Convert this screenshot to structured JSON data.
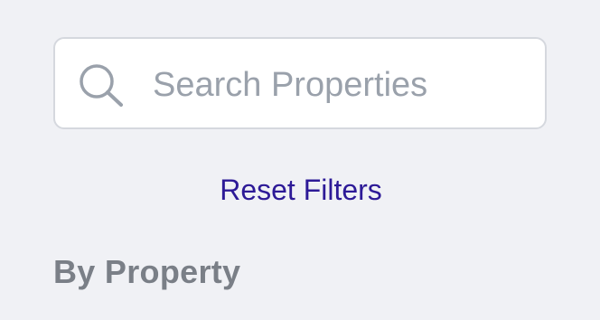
{
  "search": {
    "placeholder": "Search Properties",
    "value": "",
    "icon": "search-icon"
  },
  "filters": {
    "reset_label": "Reset Filters"
  },
  "sections": {
    "by_property_heading": "By Property"
  },
  "colors": {
    "background": "#f0f1f5",
    "input_background": "#ffffff",
    "input_border": "#d5d8de",
    "placeholder": "#9aa1ab",
    "link": "#2d1a97",
    "heading": "#7a7f87",
    "icon": "#9aa1ab"
  }
}
